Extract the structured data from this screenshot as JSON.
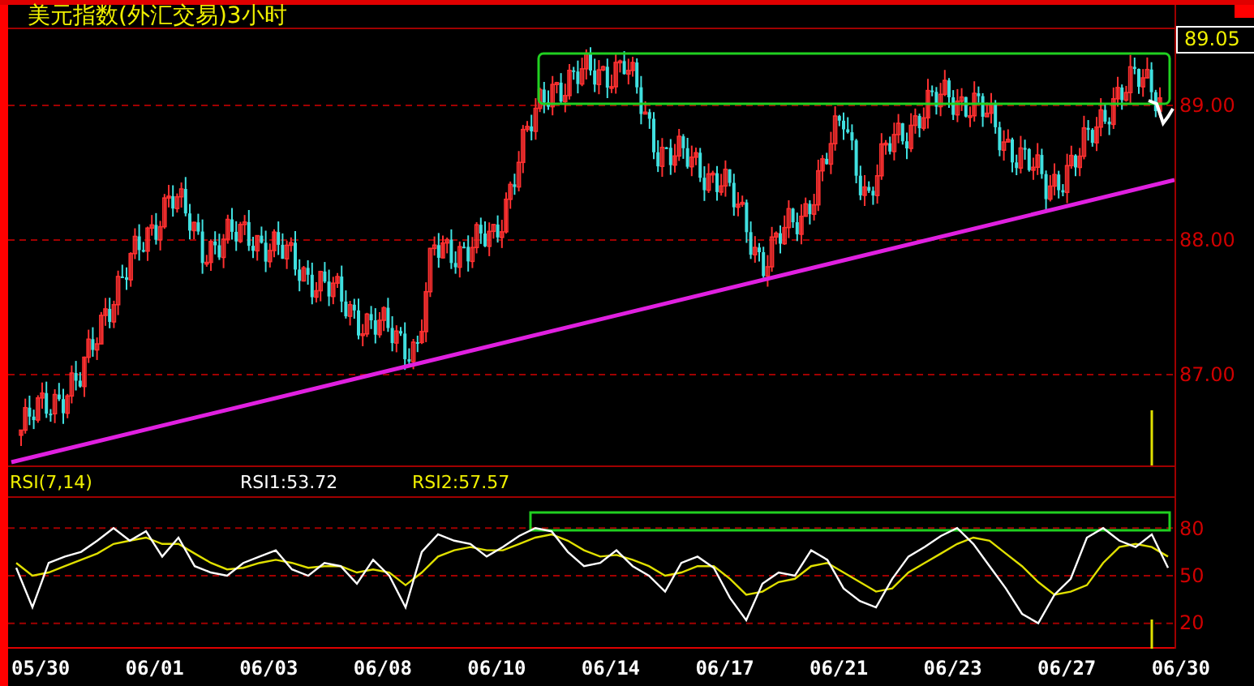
{
  "title": "美元指数(外汇交易)3小时",
  "price_axis": {
    "ticks": [
      "89.00",
      "88.00",
      "87.00"
    ],
    "last_price": "89.05"
  },
  "rsi": {
    "label": "RSI(7,14)",
    "rsi1": "RSI1:53.72",
    "rsi2": "RSI2:57.57",
    "chart_data": {
      "type": "line",
      "grid": true,
      "ylim": [
        4,
        99
      ],
      "yticks": [
        {
          "value": 80,
          "label": "80"
        },
        {
          "value": 50,
          "label": "50"
        },
        {
          "value": 20,
          "label": "20"
        }
      ],
      "series": [
        {
          "color": "#ffffff",
          "values": [
            55,
            30,
            58,
            62,
            65,
            72,
            80,
            72,
            78,
            62,
            74,
            56,
            52,
            50,
            58,
            62,
            66,
            54,
            50,
            58,
            56,
            45,
            60,
            50,
            30,
            65,
            76,
            72,
            70,
            62,
            68,
            75,
            80,
            78,
            65,
            56,
            58,
            66,
            56,
            50,
            40,
            58,
            62,
            55,
            36,
            22,
            45,
            52,
            50,
            66,
            60,
            42,
            34,
            30,
            48,
            62,
            68,
            75,
            80,
            70,
            56,
            42,
            26,
            20,
            38,
            48,
            74,
            80,
            72,
            68,
            76,
            55
          ]
        },
        {
          "color": "#e0e000",
          "values": [
            58,
            50,
            52,
            56,
            60,
            64,
            70,
            72,
            74,
            70,
            70,
            64,
            58,
            54,
            55,
            58,
            60,
            58,
            55,
            56,
            56,
            52,
            54,
            52,
            44,
            52,
            62,
            66,
            68,
            66,
            66,
            70,
            74,
            76,
            72,
            66,
            62,
            63,
            60,
            56,
            50,
            52,
            56,
            56,
            48,
            38,
            40,
            46,
            48,
            56,
            58,
            52,
            46,
            40,
            42,
            52,
            58,
            64,
            70,
            74,
            72,
            64,
            56,
            46,
            38,
            40,
            44,
            58,
            68,
            70,
            68,
            62
          ]
        }
      ]
    }
  },
  "dates": [
    "05/30",
    "06/01",
    "06/03",
    "06/08",
    "06/10",
    "06/14",
    "06/17",
    "06/21",
    "06/23",
    "06/27",
    "06/30"
  ]
}
